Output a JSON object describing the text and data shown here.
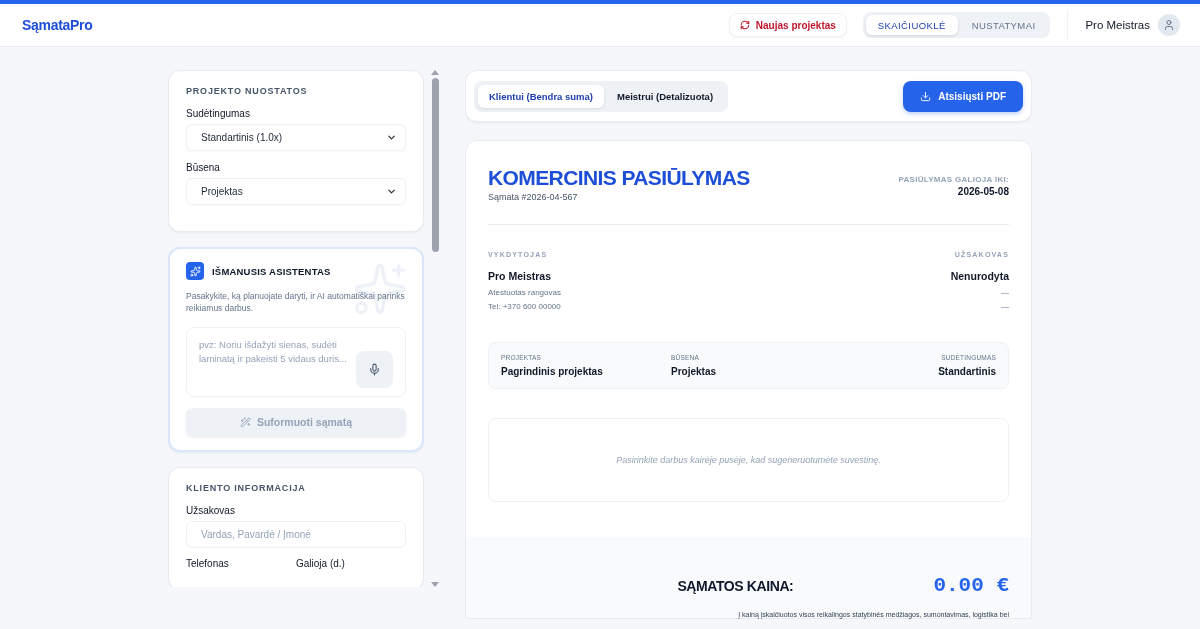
{
  "header": {
    "logo": "SąmataPro",
    "new_project": "Naujas projektas",
    "tabs": [
      {
        "label": "SKAIČIUOKLĖ",
        "selected": true
      },
      {
        "label": "NUSTATYMAI",
        "selected": false
      }
    ],
    "user": "Pro Meistras"
  },
  "sidebar": {
    "project_settings": {
      "title": "PROJEKTO NUOSTATOS",
      "fields": [
        {
          "label": "Sudėtingumas",
          "value": "Standartinis (1.0x)"
        },
        {
          "label": "Būsena",
          "value": "Projektas"
        }
      ]
    },
    "assistant": {
      "title": "IŠMANUSIS ASISTENTAS",
      "description": "Pasakykite, ką planuojate daryti, ir AI automatiškai parinks reikiamus darbus.",
      "placeholder": "pvz: Noriu išdažyti sienas, sudėti laminatą ir pakeisti 5 vidaus duris...",
      "button": "Suformuoti sąmatą",
      "button_disabled": true
    },
    "client_info": {
      "title": "KLIENTO INFORMACIJA",
      "fields": [
        {
          "label": "Užsakovas",
          "placeholder": "Vardas, Pavardė / Įmonė"
        }
      ],
      "labels": [
        "Telefonas",
        "Galioja (d.)"
      ]
    }
  },
  "toolbar": {
    "views": [
      {
        "label": "Klientui (Bendra suma)",
        "selected": true
      },
      {
        "label": "Meistrui (Detalizuota)",
        "selected": false
      }
    ],
    "download": "Atsisiųsti PDF"
  },
  "document": {
    "title": "KOMERCINIS PASIŪLYMAS",
    "number": "Sąmata #2026-04-567",
    "validity_label": "PASIŪLYMAS GALIOJA IKI:",
    "validity_date": "2026-05-08",
    "contractor": {
      "label": "VYKDYTOJAS",
      "name": "Pro Meistras",
      "lines": [
        "Atestuotas rangovas",
        "Tel: +370 600 00000"
      ]
    },
    "client": {
      "label": "UŽSAKOVAS",
      "name": "Nenurodyta",
      "lines": [
        "—",
        "—"
      ]
    },
    "summary": [
      {
        "label": "PROJEKTAS",
        "value": "Pagrindinis projektas"
      },
      {
        "label": "BŪSENA",
        "value": "Projektas"
      },
      {
        "label": "SUDĖTINGUMAS",
        "value": "Standartinis"
      }
    ],
    "empty_message": "Pasirinkite darbus kairėje pusėje, kad sugeneruotumėte suvestinę.",
    "total_label": "SĄMATOS KAINA:",
    "total": "0.00 €",
    "note": "Į kainą įskaičiuotos visos reikalingos statybinės medžiagos, sumontavimas, logistika bei"
  }
}
